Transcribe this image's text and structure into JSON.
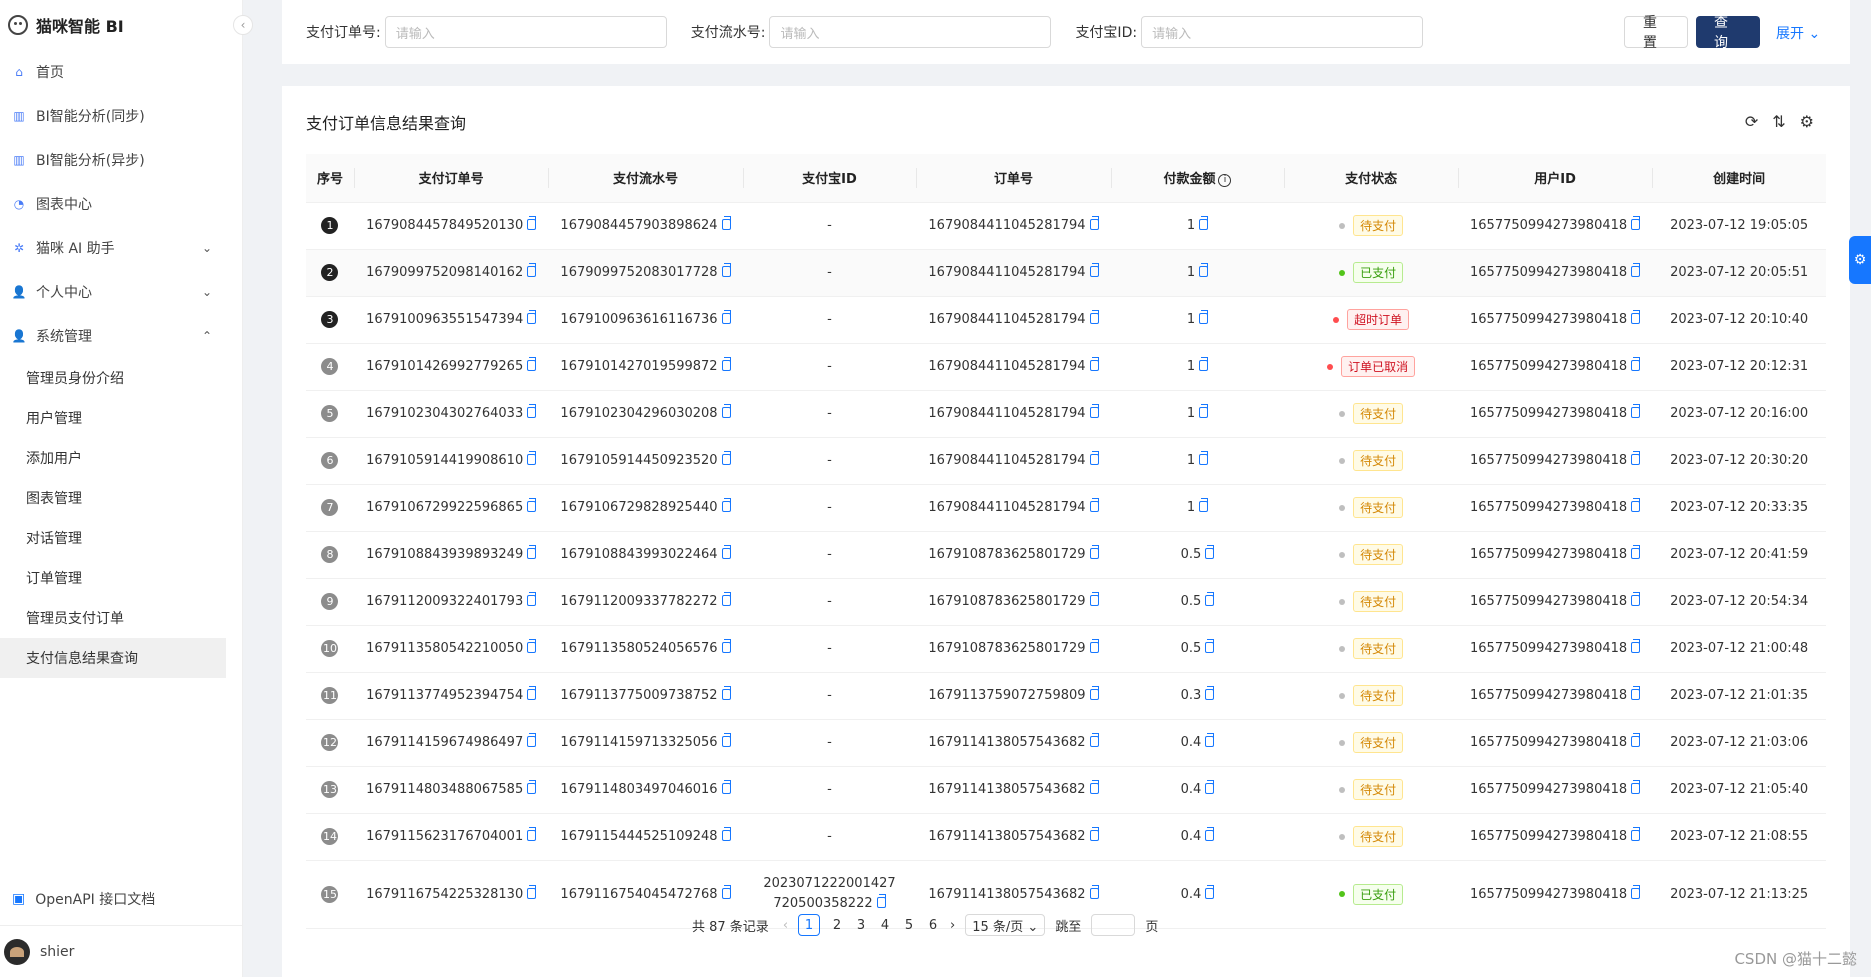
{
  "app": {
    "title": "猫咪智能 BI"
  },
  "sidebar": {
    "collapse_icon": "‹",
    "items": [
      {
        "label": "首页",
        "icon": "home"
      },
      {
        "label": "BI智能分析(同步)",
        "icon": "bar-chart"
      },
      {
        "label": "BI智能分析(异步)",
        "icon": "bar-chart"
      },
      {
        "label": "图表中心",
        "icon": "pie"
      },
      {
        "label": "猫咪 AI 助手",
        "icon": "robot",
        "chevron": "⌄"
      },
      {
        "label": "个人中心",
        "icon": "user",
        "chevron": "⌄"
      },
      {
        "label": "系统管理",
        "icon": "user",
        "chevron": "⌃"
      }
    ],
    "sub_items": [
      {
        "label": "管理员身份介绍"
      },
      {
        "label": "用户管理"
      },
      {
        "label": "添加用户"
      },
      {
        "label": "图表管理"
      },
      {
        "label": "对话管理"
      },
      {
        "label": "订单管理"
      },
      {
        "label": "管理员支付订单"
      },
      {
        "label": "支付信息结果查询"
      }
    ],
    "openapi_label": "OpenAPI 接口文档",
    "username": "shier"
  },
  "filter": {
    "fields": [
      {
        "label": "支付订单号:",
        "placeholder": "请输入"
      },
      {
        "label": "支付流水号:",
        "placeholder": "请输入"
      },
      {
        "label": "支付宝ID:",
        "placeholder": "请输入"
      }
    ],
    "reset_label": "重 置",
    "query_label": "查 询",
    "expand_label": "展开 ⌄"
  },
  "card": {
    "title": "支付订单信息结果查询",
    "tools": [
      "⟳",
      "⇅",
      "⚙"
    ]
  },
  "table": {
    "headers": [
      "序号",
      "支付订单号",
      "支付流水号",
      "支付宝ID",
      "订单号",
      "付款金额",
      "支付状态",
      "用户ID",
      "创建时间"
    ],
    "amount_info": "i",
    "rows": [
      {
        "idx": "1",
        "pay_id": "1679084457849520130",
        "serial": "1679084457903898624",
        "alipay": "-",
        "order": "1679084411045281794",
        "amount": "1",
        "status": "待支付",
        "user": "1657750994273980418",
        "time": "2023-07-12 19:05:05"
      },
      {
        "idx": "2",
        "pay_id": "1679099752098140162",
        "serial": "1679099752083017728",
        "alipay": "-",
        "order": "1679084411045281794",
        "amount": "1",
        "status": "已支付",
        "user": "1657750994273980418",
        "time": "2023-07-12 20:05:51"
      },
      {
        "idx": "3",
        "pay_id": "1679100963551547394",
        "serial": "1679100963616116736",
        "alipay": "-",
        "order": "1679084411045281794",
        "amount": "1",
        "status": "超时订单",
        "user": "1657750994273980418",
        "time": "2023-07-12 20:10:40"
      },
      {
        "idx": "4",
        "pay_id": "1679101426992779265",
        "serial": "1679101427019599872",
        "alipay": "-",
        "order": "1679084411045281794",
        "amount": "1",
        "status": "订单已取消",
        "user": "1657750994273980418",
        "time": "2023-07-12 20:12:31"
      },
      {
        "idx": "5",
        "pay_id": "1679102304302764033",
        "serial": "1679102304296030208",
        "alipay": "-",
        "order": "1679084411045281794",
        "amount": "1",
        "status": "待支付",
        "user": "1657750994273980418",
        "time": "2023-07-12 20:16:00"
      },
      {
        "idx": "6",
        "pay_id": "1679105914419908610",
        "serial": "1679105914450923520",
        "alipay": "-",
        "order": "1679084411045281794",
        "amount": "1",
        "status": "待支付",
        "user": "1657750994273980418",
        "time": "2023-07-12 20:30:20"
      },
      {
        "idx": "7",
        "pay_id": "1679106729922596865",
        "serial": "1679106729828925440",
        "alipay": "-",
        "order": "1679084411045281794",
        "amount": "1",
        "status": "待支付",
        "user": "1657750994273980418",
        "time": "2023-07-12 20:33:35"
      },
      {
        "idx": "8",
        "pay_id": "1679108843939893249",
        "serial": "1679108843993022464",
        "alipay": "-",
        "order": "1679108783625801729",
        "amount": "0.5",
        "status": "待支付",
        "user": "1657750994273980418",
        "time": "2023-07-12 20:41:59"
      },
      {
        "idx": "9",
        "pay_id": "1679112009322401793",
        "serial": "1679112009337782272",
        "alipay": "-",
        "order": "1679108783625801729",
        "amount": "0.5",
        "status": "待支付",
        "user": "1657750994273980418",
        "time": "2023-07-12 20:54:34"
      },
      {
        "idx": "10",
        "pay_id": "1679113580542210050",
        "serial": "1679113580524056576",
        "alipay": "-",
        "order": "1679108783625801729",
        "amount": "0.5",
        "status": "待支付",
        "user": "1657750994273980418",
        "time": "2023-07-12 21:00:48"
      },
      {
        "idx": "11",
        "pay_id": "1679113774952394754",
        "serial": "1679113775009738752",
        "alipay": "-",
        "order": "1679113759072759809",
        "amount": "0.3",
        "status": "待支付",
        "user": "1657750994273980418",
        "time": "2023-07-12 21:01:35"
      },
      {
        "idx": "12",
        "pay_id": "1679114159674986497",
        "serial": "1679114159713325056",
        "alipay": "-",
        "order": "1679114138057543682",
        "amount": "0.4",
        "status": "待支付",
        "user": "1657750994273980418",
        "time": "2023-07-12 21:03:06"
      },
      {
        "idx": "13",
        "pay_id": "1679114803488067585",
        "serial": "1679114803497046016",
        "alipay": "-",
        "order": "1679114138057543682",
        "amount": "0.4",
        "status": "待支付",
        "user": "1657750994273980418",
        "time": "2023-07-12 21:05:40"
      },
      {
        "idx": "14",
        "pay_id": "1679115623176704001",
        "serial": "1679115444525109248",
        "alipay": "-",
        "order": "1679114138057543682",
        "amount": "0.4",
        "status": "待支付",
        "user": "1657750994273980418",
        "time": "2023-07-12 21:08:55"
      },
      {
        "idx": "15",
        "pay_id": "1679116754225328130",
        "serial": "1679116754045472768",
        "alipay": "2023071222001427720500358222",
        "order": "1679114138057543682",
        "amount": "0.4",
        "status": "已支付",
        "user": "1657750994273980418",
        "time": "2023-07-12 21:13:25"
      }
    ]
  },
  "pagination": {
    "total": "共 87 条记录",
    "prev": "‹",
    "next": "›",
    "pages": [
      "1",
      "2",
      "3",
      "4",
      "5",
      "6"
    ],
    "page_size": "15 条/页 ⌄",
    "jump_label": "跳至",
    "page_unit": "页"
  },
  "watermark": "CSDN @猫十二懿",
  "colors": {
    "primary": "#1f3a6e",
    "link": "#1677ff",
    "pending": "#d48806",
    "paid": "#389e0d",
    "error": "#cf1322"
  }
}
